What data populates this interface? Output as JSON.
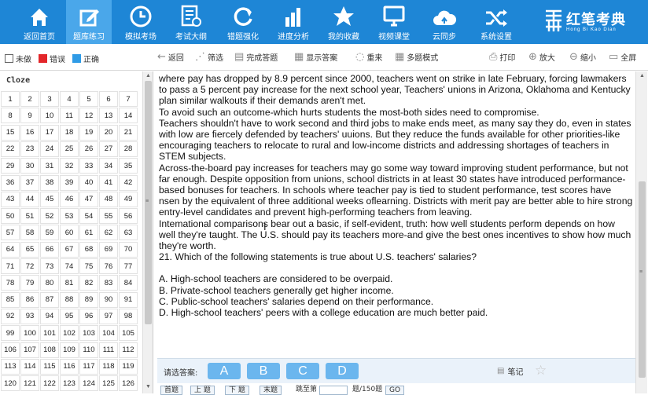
{
  "nav": [
    {
      "label": "返回首页",
      "icon": "home-icon"
    },
    {
      "label": "题库练习",
      "icon": "edit-icon",
      "active": true
    },
    {
      "label": "模拟考场",
      "icon": "clock-icon"
    },
    {
      "label": "考试大纲",
      "icon": "outline-icon"
    },
    {
      "label": "错题强化",
      "icon": "refresh-icon"
    },
    {
      "label": "进度分析",
      "icon": "bar-chart-icon"
    },
    {
      "label": "我的收藏",
      "icon": "star-icon"
    },
    {
      "label": "视频课堂",
      "icon": "monitor-icon"
    },
    {
      "label": "云同步",
      "icon": "cloud-icon"
    },
    {
      "label": "系统设置",
      "icon": "shuffle-icon"
    }
  ],
  "brand": {
    "cn": "红笔考典",
    "en": "Hong Bi Kao Dian"
  },
  "legend": [
    {
      "label": "未做",
      "color": "#ffffff"
    },
    {
      "label": "错误",
      "color": "#e3262a"
    },
    {
      "label": "正确",
      "color": "#2f9be6"
    }
  ],
  "toolbar": {
    "back": "返回",
    "filter": "筛选",
    "done": "完成答题",
    "show": "显示答案",
    "redo": "重来",
    "multi": "多题模式",
    "print": "打印",
    "zoom_in": "放大",
    "zoom_out": "缩小",
    "full": "全屏"
  },
  "section_label": "Cloze",
  "question_numbers": [
    1,
    2,
    3,
    4,
    5,
    6,
    7,
    8,
    9,
    10,
    11,
    12,
    13,
    14,
    15,
    16,
    17,
    18,
    19,
    20,
    21,
    22,
    23,
    24,
    25,
    26,
    27,
    28,
    29,
    30,
    31,
    32,
    33,
    34,
    35,
    36,
    37,
    38,
    39,
    40,
    41,
    42,
    43,
    44,
    45,
    46,
    47,
    48,
    49,
    50,
    51,
    52,
    53,
    54,
    55,
    56,
    57,
    58,
    59,
    60,
    61,
    62,
    63,
    64,
    65,
    66,
    67,
    68,
    69,
    70,
    71,
    72,
    73,
    74,
    75,
    76,
    77,
    78,
    79,
    80,
    81,
    82,
    83,
    84,
    85,
    86,
    87,
    88,
    89,
    90,
    91,
    92,
    93,
    94,
    95,
    96,
    97,
    98,
    99,
    100,
    101,
    102,
    103,
    104,
    105,
    106,
    107,
    108,
    109,
    110,
    111,
    112,
    113,
    114,
    115,
    116,
    117,
    118,
    119,
    120,
    121,
    122,
    123,
    124,
    125,
    126
  ],
  "passage": [
    "where pay has dropped by 8.9 percent since 2000, teachers went on strike in late February, forcing lawmakers to pass a 5 percent pay increase for the next school year, Teachers' unions in Arizona, Oklahoma and Kentucky plan similar walkouts if their demands aren't met.",
    "To avoid such an outcome-which hurts students the most-both sides need to compromise.",
    "Teachers shouldn't have to work second and third jobs to make ends meet, as many say they do, even in states with low are fiercely defended by teachers' uuions. But they reduce the funds available for other priorities-like encouraging teachers to relocate to rural and low-income districts and addressing shortages of teachers in STEM subjects.",
    "Across-the-board pay increases for teachers may go some way toward improving student performance, but not far enough. Despite opposition from unions, school districts in at least 30 states have introduced performance-based bonuses for teachers. In schools where teacher pay is tied to student performance, test scores have nsen by the equivalent of three additional weeks oflearning. Districts with merit pay are better able to hire strong entry-level candidates and prevent high-performing teachers from leaving.",
    "Intemational comparisons bear out a basic, if self-evident, truth: how well students perform depends on how well they're taught. The U.S. should pay its teachers more-and give the best ones incentives to show how much they're worth.",
    "21. Which of the following statements is true about U.S. teachers' salaries?"
  ],
  "options": [
    "A. High-school teachers are considered to be overpaid.",
    "B. Private-school teachers generally get higher income.",
    "C. Public-school teachers' salaries depend on their performance.",
    "D. High-school teachers' peers with a college education are much better paid."
  ],
  "answer": {
    "prompt": "请选答案:",
    "choices": [
      "A",
      "B",
      "C",
      "D"
    ],
    "note": "笔记"
  },
  "bottom": {
    "first": "首题",
    "prev": "上 题",
    "next": "下 题",
    "last": "末题",
    "jump": "跳至第",
    "of": "题/150题",
    "go": "GO"
  }
}
